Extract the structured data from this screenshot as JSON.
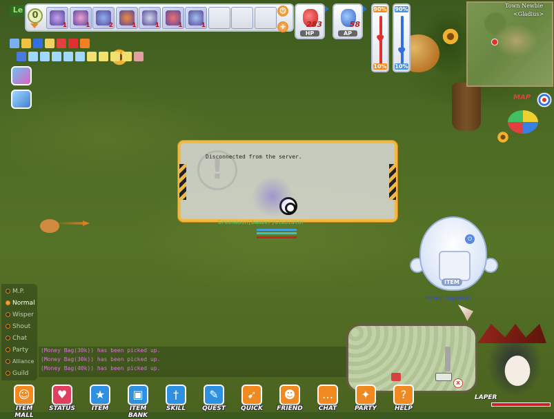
{
  "window": {
    "title": ""
  },
  "quickbar": {
    "count": "0",
    "slots": [
      {
        "icon": "purple-ring-skill",
        "qty": "1"
      },
      {
        "icon": "pink-orb-skill",
        "qty": "1"
      },
      {
        "icon": "blue-chain-skill",
        "qty": "2"
      },
      {
        "icon": "fire-skill",
        "qty": "1"
      },
      {
        "icon": "scroll-skill",
        "qty": "1"
      },
      {
        "icon": "explosion-skill",
        "qty": "1"
      },
      {
        "icon": "card-skill",
        "qty": "1"
      },
      {
        "icon": "empty",
        "qty": ""
      },
      {
        "icon": "empty",
        "qty": ""
      },
      {
        "icon": "empty",
        "qty": ""
      }
    ]
  },
  "potions": {
    "hp": {
      "label": "HP",
      "count": "283"
    },
    "ap": {
      "label": "AP",
      "count": "58"
    }
  },
  "gauges": {
    "hp": {
      "top": "90%",
      "bottom": "10%",
      "color": "#e03030"
    },
    "ap": {
      "top": "90%",
      "bottom": "10%",
      "color": "#3070e0"
    }
  },
  "minimap": {
    "title": "Town Newbie",
    "subtitle": "<Gladius>",
    "map_button": "MAP"
  },
  "dialog": {
    "message": "Disconnected from the server."
  },
  "character": {
    "name": "Greenmoon[Bamber]Gladiator"
  },
  "item_egg": {
    "label": "ITEM"
  },
  "drop": {
    "label": "Money Bag(90k)"
  },
  "chat": {
    "tabs": [
      "M.P.",
      "Normal",
      "Wisper",
      "Shout",
      "Chat",
      "Party",
      "Alliance",
      "Guild"
    ],
    "active_tab": "Normal",
    "lines": [
      "(Money Bag(30k)) has been picked up.",
      "(Money Bag(30k)) has been picked up.",
      "(Money Bag(40k)) has been picked up."
    ]
  },
  "menu": [
    {
      "label": "ITEM MALL",
      "icon": "mall-icon",
      "color": "#f08a20"
    },
    {
      "label": "STATUS",
      "icon": "heart-icon",
      "color": "#e04060"
    },
    {
      "label": "ITEM",
      "icon": "box-icon",
      "color": "#3090e0"
    },
    {
      "label": "ITEM BANK",
      "icon": "chest-icon",
      "color": "#3090e0"
    },
    {
      "label": "SKILL",
      "icon": "sword-icon",
      "color": "#3090e0"
    },
    {
      "label": "QUEST",
      "icon": "scroll-icon",
      "color": "#3090e0"
    },
    {
      "label": "QUICK",
      "icon": "quick-icon",
      "color": "#f08a20"
    },
    {
      "label": "FRIEND",
      "icon": "friend-icon",
      "color": "#f08a20"
    },
    {
      "label": "CHAT",
      "icon": "chat-icon",
      "color": "#f08a20"
    },
    {
      "label": "PARTY",
      "icon": "party-icon",
      "color": "#f08a20"
    },
    {
      "label": "HELP",
      "icon": "help-icon",
      "color": "#f08a20"
    }
  ],
  "portrait": {
    "name": "LAPER"
  },
  "colors": {
    "dialog_border": "#f2b840",
    "chat_text": "#e070e0",
    "drop_text": "#3050d0",
    "name_text": "#6ad070"
  }
}
